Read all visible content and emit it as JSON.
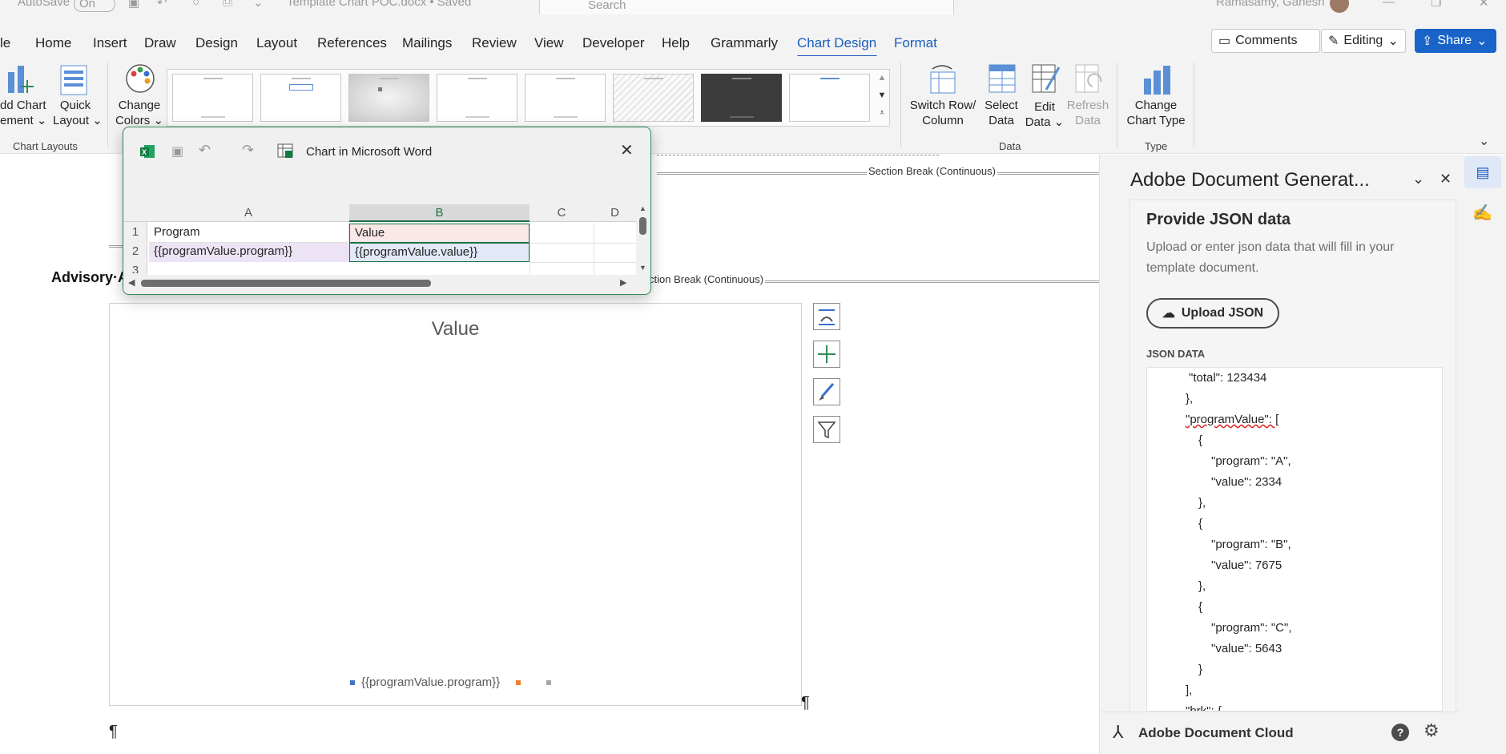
{
  "titlebar": {
    "autosave": "AutoSave",
    "toggle": "On",
    "doc_title": "Template Chart POC.docx • Saved",
    "search_placeholder": "Search",
    "user": "Ramasamy, Ganesh"
  },
  "tabs": [
    "le",
    "Home",
    "Insert",
    "Draw",
    "Design",
    "Layout",
    "References",
    "Mailings",
    "Review",
    "View",
    "Developer",
    "Help",
    "Grammarly",
    "Chart Design",
    "Format"
  ],
  "top_buttons": {
    "comments": "Comments",
    "editing": "Editing",
    "share": "Share"
  },
  "ribbon": {
    "add_chart_element": [
      "dd Chart",
      "ement"
    ],
    "quick_layout": [
      "Quick",
      "Layout"
    ],
    "change_colors": [
      "Change",
      "Colors"
    ],
    "chart_layouts_group": "Chart Layouts",
    "switch_row_column": [
      "Switch Row/",
      "Column"
    ],
    "select_data": [
      "Select",
      "Data"
    ],
    "edit_data": [
      "Edit",
      "Data"
    ],
    "refresh_data": [
      "Refresh",
      "Data"
    ],
    "data_group": "Data",
    "change_chart_type": [
      "Change",
      "Chart Type"
    ],
    "type_group": "Type"
  },
  "document": {
    "section_break_1": "Section Break (Continuous)",
    "section_break_2": "ction Break (Continuous)",
    "heading": "Advisory·A",
    "pilcrow": "¶"
  },
  "chart": {
    "title": "Value",
    "legend_entry": "{{programValue.program}}",
    "legend_colors": [
      "#4472c4",
      "#ed7d31",
      "#a5a5a5"
    ]
  },
  "excel": {
    "title": "Chart in Microsoft Word",
    "columns": [
      "A",
      "B",
      "C",
      "D"
    ],
    "rows": [
      "1",
      "2",
      "3"
    ],
    "cells": {
      "a1": "Program",
      "b1": "Value",
      "a2": "{{programValue.program}}",
      "b2": "{{programValue.value}}"
    }
  },
  "pane": {
    "title": "Adobe Document Generat...",
    "heading": "Provide JSON data",
    "description_1": "Upload or enter json data that will fill in your",
    "description_2": "template document.",
    "upload_button": "Upload JSON",
    "json_label": "JSON DATA",
    "json_lines": [
      "\"total\": 123434",
      "},",
      "\"programValue\": [",
      "{",
      "\"program\": \"A\",",
      "\"value\": 2334",
      "},",
      "{",
      "\"program\": \"B\",",
      "\"value\": 7675",
      "},",
      "{",
      "\"program\": \"C\",",
      "\"value\": 5643",
      "}",
      "],",
      "\"brk\": {"
    ],
    "footer": "Adobe Document Cloud"
  }
}
